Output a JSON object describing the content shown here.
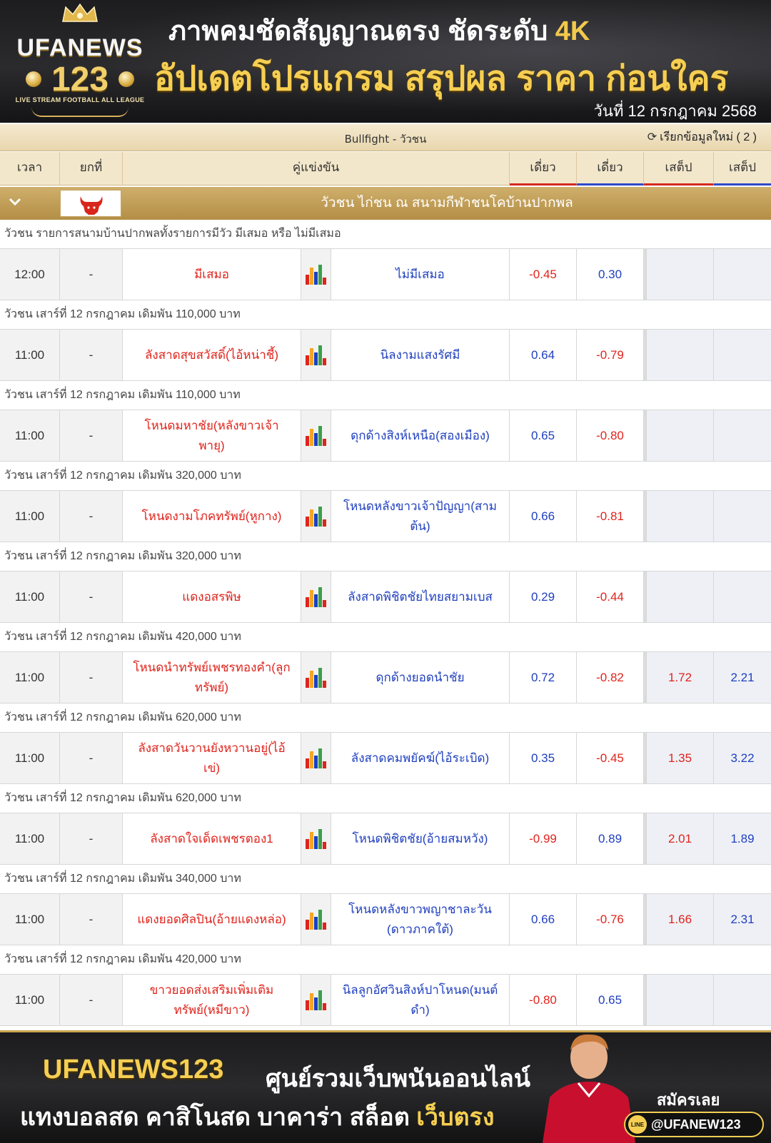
{
  "header": {
    "logo_brand": "UFANEWS",
    "logo_number": "123",
    "logo_tagline": "LIVE STREAM FOOTBALL ALL LEAGUE",
    "headline_1": "ภาพคมชัดสัญญาณตรง ชัดระดับ",
    "headline_1_accent": "4K",
    "headline_2": "อัปเดตโปรแกรม สรุปผล ราคา ก่อนใคร",
    "date": "วันที่ 12 กรกฎาคม 2568"
  },
  "sport_bar": {
    "title": "Bullfight - วัวชน",
    "refresh_label": "เรียกข้อมูลใหม่ ( 2 )"
  },
  "columns": {
    "time": "เวลา",
    "handicap": "ยกที่",
    "match": "คู่แข่งขัน",
    "odds_1": "เดี่ยว",
    "odds_2": "เดี่ยว",
    "step_1": "เสต็ป",
    "step_2": "เสต็ป"
  },
  "league": {
    "name": "วัวชน ไก่ชน ณ สนามกีฬาชนโคบ้านปากพล"
  },
  "colors": {
    "home_red": "#e0241c",
    "away_blue": "#1f3fbf",
    "gold": "#f6cf52"
  },
  "matches": [
    {
      "group": "วัวชน รายการสนามบ้านปากพลทั้งรายการมีวัว มีเสมอ หรือ ไม่มีเสมอ",
      "time": "12:00",
      "hcap": "-",
      "home": "มีเสมอ",
      "away": "ไม่มีเสมอ",
      "o1": "-0.45",
      "o2": "0.30",
      "o3": "",
      "o4": ""
    },
    {
      "group": "วัวชน เสาร์ที่ 12 กรกฎาคม เดิมพัน 110,000 บาท",
      "time": "11:00",
      "hcap": "-",
      "home": "ลังสาดสุขสวัสดิ์(ไอ้หน่าชี้)",
      "away": "นิลงามแสงรัศมี",
      "o1": "0.64",
      "o2": "-0.79",
      "o3": "",
      "o4": ""
    },
    {
      "group": "วัวชน เสาร์ที่ 12 กรกฎาคม เดิมพัน 110,000 บาท",
      "time": "11:00",
      "hcap": "-",
      "home": "โหนดมหาชัย(หลังขาวเจ้าพายุ)",
      "away": "ดุกด้างสิงห์เหนือ(สองเมือง)",
      "o1": "0.65",
      "o2": "-0.80",
      "o3": "",
      "o4": ""
    },
    {
      "group": "วัวชน เสาร์ที่ 12 กรกฎาคม เดิมพัน 320,000 บาท",
      "time": "11:00",
      "hcap": "-",
      "home": "โหนดงามโภคทรัพย์(หูกาง)",
      "away": "โหนดหลังขาวเจ้าปัญญา(สามต้น)",
      "o1": "0.66",
      "o2": "-0.81",
      "o3": "",
      "o4": ""
    },
    {
      "group": "วัวชน เสาร์ที่ 12 กรกฎาคม เดิมพัน 320,000 บาท",
      "time": "11:00",
      "hcap": "-",
      "home": "แดงอสรพิษ",
      "away": "ลังสาดพิชิตชัยไทยสยามเบส",
      "o1": "0.29",
      "o2": "-0.44",
      "o3": "",
      "o4": ""
    },
    {
      "group": "วัวชน เสาร์ที่ 12 กรกฎาคม เดิมพัน 420,000 บาท",
      "time": "11:00",
      "hcap": "-",
      "home": "โหนดนำทรัพย์เพชรทองคำ(ลูกทรัพย์)",
      "away": "ดุกด้างยอดนำชัย",
      "o1": "0.72",
      "o2": "-0.82",
      "o3": "1.72",
      "o4": "2.21"
    },
    {
      "group": "วัวชน เสาร์ที่ 12 กรกฎาคม เดิมพัน 620,000 บาท",
      "time": "11:00",
      "hcap": "-",
      "home": "ลังสาดวันวานยังหวานอยู่(ไอ้เข่)",
      "away": "ลังสาดคมพยัคฆ์(ไอ้ระเบิด)",
      "o1": "0.35",
      "o2": "-0.45",
      "o3": "1.35",
      "o4": "3.22"
    },
    {
      "group": "วัวชน เสาร์ที่ 12 กรกฎาคม เดิมพัน 620,000 บาท",
      "time": "11:00",
      "hcap": "-",
      "home": "ลังสาดใจเด็ดเพชรตอง1",
      "away": "โหนดพิชิตชัย(อ้ายสมหวัง)",
      "o1": "-0.99",
      "o2": "0.89",
      "o3": "2.01",
      "o4": "1.89"
    },
    {
      "group": "วัวชน เสาร์ที่ 12 กรกฎาคม เดิมพัน 340,000 บาท",
      "time": "11:00",
      "hcap": "-",
      "home": "แดงยอดศิลปิน(อ้ายแดงหล่อ)",
      "away": "โหนดหลังขาวพญาชาละวัน (ดาวภาคใต้)",
      "o1": "0.66",
      "o2": "-0.76",
      "o3": "1.66",
      "o4": "2.31"
    },
    {
      "group": "วัวชน เสาร์ที่ 12 กรกฎาคม เดิมพัน 420,000 บาท",
      "time": "11:00",
      "hcap": "-",
      "home": "ขาวยอดส่งเสริมเพิ่มเติมทรัพย์(หมีขาว)",
      "away": "นิลลูกอัศวินสิงห์ปาโหนด(มนต์ดำ)",
      "o1": "-0.80",
      "o2": "0.65",
      "o3": "",
      "o4": ""
    }
  ],
  "footer": {
    "brand": "UFANEWS123",
    "line_1": "ศูนย์รวมเว็บพนันออนไลน์",
    "line_2": "แทงบอลสด คาสิโนสด บาคาร่า สล็อต",
    "line_2_accent": "เว็บตรง",
    "signup": "สมัครเลย",
    "line_badge": "LINE",
    "line_id": "@UFANEW123"
  }
}
